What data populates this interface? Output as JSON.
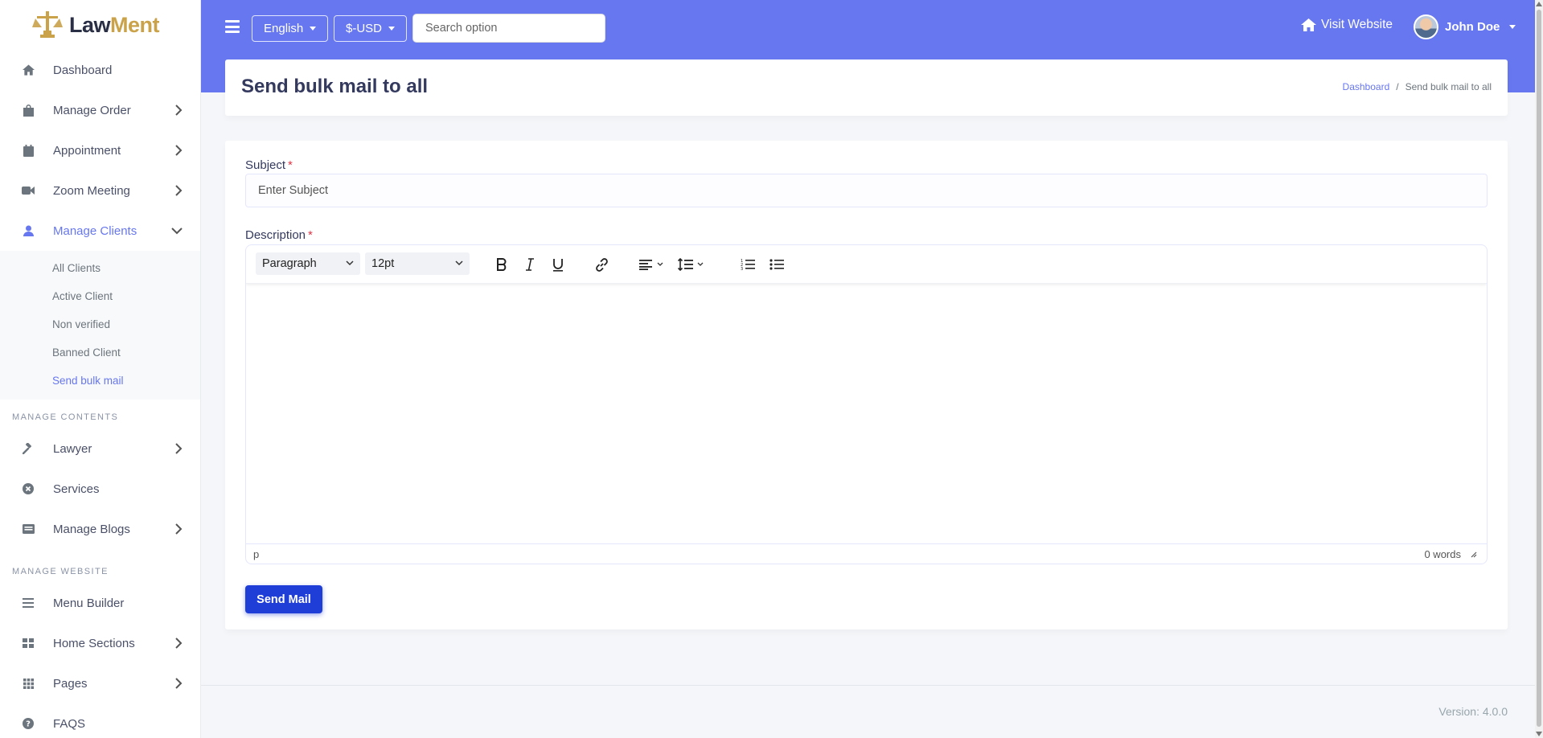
{
  "brand": {
    "part1": "Law",
    "part2": "Ment"
  },
  "sidebar": {
    "items": [
      {
        "label": "Dashboard",
        "icon": "home-icon"
      },
      {
        "label": "Manage Order",
        "icon": "bag-icon"
      },
      {
        "label": "Appointment",
        "icon": "calendar-icon"
      },
      {
        "label": "Zoom Meeting",
        "icon": "video-icon"
      },
      {
        "label": "Manage Clients",
        "icon": "user-icon"
      }
    ],
    "client_submenu": [
      "All Clients",
      "Active Client",
      "Non verified",
      "Banned Client",
      "Send bulk mail"
    ],
    "section_contents": "MANAGE CONTENTS",
    "content_items": [
      {
        "label": "Lawyer",
        "icon": "gavel-icon"
      },
      {
        "label": "Services",
        "icon": "circle-x-icon"
      },
      {
        "label": "Manage Blogs",
        "icon": "newspaper-icon"
      }
    ],
    "section_website": "MANAGE WEBSITE",
    "website_items": [
      {
        "label": "Menu Builder",
        "icon": "bars-icon"
      },
      {
        "label": "Home Sections",
        "icon": "grid-icon"
      },
      {
        "label": "Pages",
        "icon": "apps-icon"
      },
      {
        "label": "FAQS",
        "icon": "question-icon"
      }
    ]
  },
  "topbar": {
    "language": "English",
    "currency": "$-USD",
    "search_placeholder": "Search option",
    "visit_website": "Visit Website",
    "user_name": "John Doe"
  },
  "page": {
    "title": "Send bulk mail to all",
    "breadcrumb_home": "Dashboard",
    "breadcrumb_sep": "/",
    "breadcrumb_current": "Send bulk mail to all"
  },
  "form": {
    "subject_label": "Subject",
    "required_mark": "*",
    "subject_placeholder": "Enter Subject",
    "description_label": "Description",
    "editor": {
      "block_format": "Paragraph",
      "font_size": "12pt",
      "path": "p",
      "word_count": "0 words"
    },
    "submit_label": "Send Mail"
  },
  "footer": {
    "version": "Version: 4.0.0"
  },
  "colors": {
    "primary": "#6777ef",
    "submit": "#1f3ed8",
    "brand_gold": "#c9a24a",
    "required": "#dc3545"
  }
}
